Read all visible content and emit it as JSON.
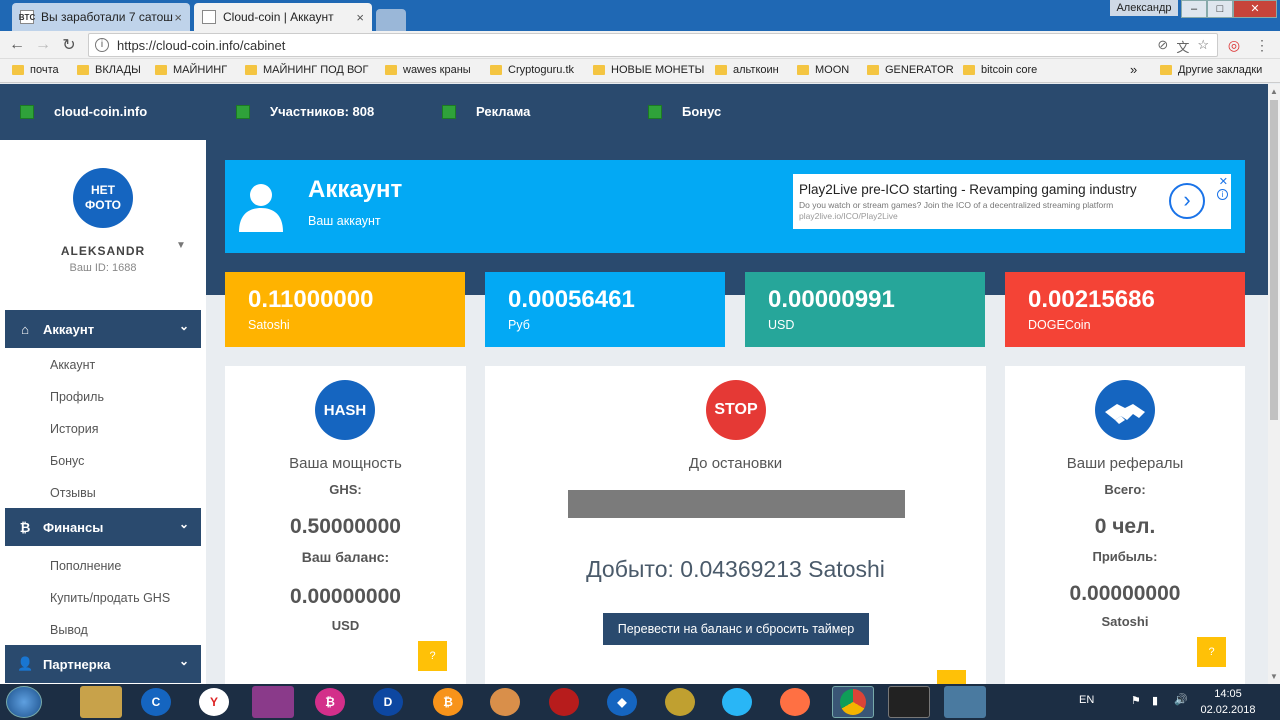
{
  "browser": {
    "tabs": [
      {
        "favicon": "BTC",
        "title": "Вы заработали 7 сатош",
        "close": "×"
      },
      {
        "favicon": "",
        "title": "Cloud-coin | Аккаунт",
        "close": "×"
      }
    ],
    "window_user": "Александр",
    "window_buttons": {
      "minimize": "–",
      "maximize": "□",
      "close": "✕"
    },
    "url": "https://cloud-coin.info/cabinet",
    "bookmarks": [
      "почта",
      "ВКЛАДЫ",
      "МАЙНИНГ",
      "МАЙНИНГ ПОД ВОГ",
      "wawes краны",
      "Cryptoguru.tk",
      "НОВЫЕ МОНЕТЫ",
      "альткоин",
      "MOON",
      "GENERATOR",
      "bitcoin  core"
    ],
    "bookmarks_more": "»",
    "other_bookmarks": "Другие закладки"
  },
  "topnav": {
    "brand": "cloud-coin.info",
    "participants": "Участников: 808",
    "ads": "Реклама",
    "bonus": "Бонус"
  },
  "sidebar": {
    "avatar_text": "НЕТ ФОТО",
    "username": "ALEKSANDR",
    "user_id": "Ваш ID: 1688",
    "sections": [
      {
        "title": "Аккаунт",
        "icon": "home-icon",
        "links": [
          "Аккаунт",
          "Профиль",
          "История",
          "Бонус",
          "Отзывы"
        ]
      },
      {
        "title": "Финансы",
        "icon": "bitcoin-icon",
        "links": [
          "Пополнение",
          "Купить/продать GHS",
          "Вывод"
        ]
      },
      {
        "title": "Партнерка",
        "icon": "users-icon",
        "links": []
      }
    ]
  },
  "hero": {
    "title": "Аккаунт",
    "subtitle": "Ваш аккаунт"
  },
  "ad": {
    "title": "Play2Live pre-ICO starting - Revamping gaming industry",
    "description": "Do you watch or stream games? Join the ICO of a decentralized streaming platform",
    "url": "play2live.io/ICO/Play2Live",
    "close": "✕",
    "info": "i"
  },
  "stats": [
    {
      "value": "0.11000000",
      "label": "Satoshi",
      "color": "#ffb300"
    },
    {
      "value": "0.00056461",
      "label": "Руб",
      "color": "#03a9f4"
    },
    {
      "value": "0.00000991",
      "label": "USD",
      "color": "#26a69a"
    },
    {
      "value": "0.00215686",
      "label": "DOGECoin",
      "color": "#f44336"
    }
  ],
  "hash_card": {
    "badge": "HASH",
    "title": "Ваша мощность",
    "power_label": "GHS:",
    "power_value": "0.50000000",
    "balance_label": "Ваш баланс:",
    "balance_value": "0.00000000",
    "balance_unit": "USD",
    "help": "?"
  },
  "stop_card": {
    "badge": "STOP",
    "title": "До остановки",
    "progress": 0,
    "mined": "Добыто: 0.04369213 Satoshi",
    "button": "Перевести на баланс и сбросить таймер"
  },
  "ref_card": {
    "title": "Ваши рефералы",
    "total_label": "Всего:",
    "total_value": "0 чел.",
    "profit_label": "Прибыль:",
    "profit_value": "0.00000000",
    "profit_unit": "Satoshi",
    "help": "?"
  },
  "taskbar": {
    "lang": "EN",
    "time": "14:05",
    "date": "02.02.2018"
  },
  "colors": {
    "navy": "#2a4a6e",
    "accent_blue": "#03a9f4",
    "hash_blue": "#1565c0",
    "stop_red": "#e53935",
    "taskbar": "#1c2e44"
  }
}
